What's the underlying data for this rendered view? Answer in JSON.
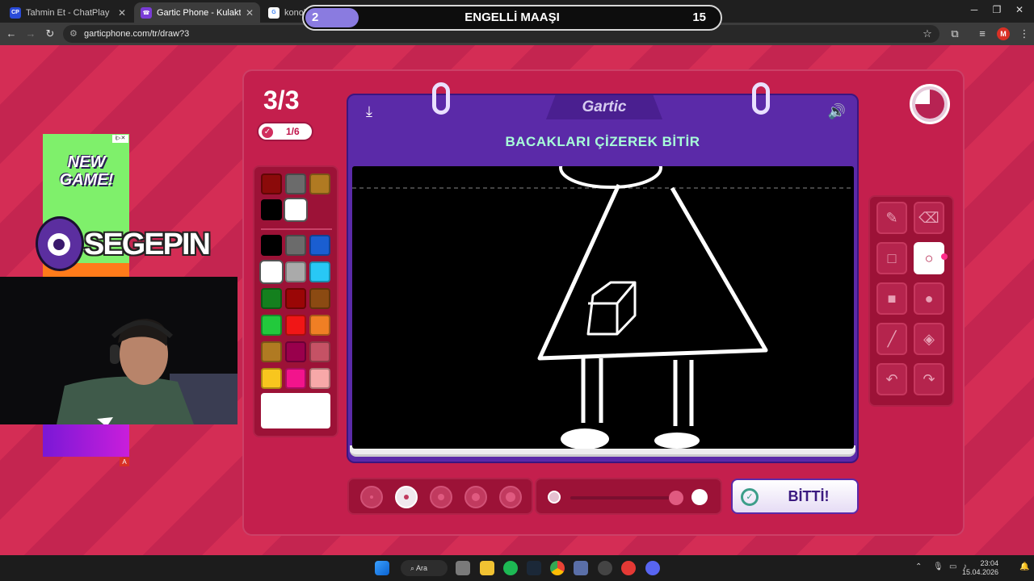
{
  "browser": {
    "tabs": [
      {
        "title": "Tahmin Et - ChatPlay",
        "favicon": "CP",
        "active": false
      },
      {
        "title": "Gartic Phone - Kulaktan Kulağa",
        "favicon": "☎",
        "active": true
      },
      {
        "title": "konoha",
        "favicon": "G",
        "active": false
      }
    ],
    "new_tab_label": "+",
    "url": "garticphone.com/tr/draw?3"
  },
  "round_banner": {
    "count": "2",
    "word": "ENGELLİ MAAŞI",
    "timer": "15"
  },
  "game": {
    "turn": "3/3",
    "rating": "1/6",
    "brand": "Gartic",
    "task": "BACAKLARI ÇİZEREK BİTİR",
    "done_label": "BİTTİ!",
    "selected_tool": "ellipse-outline",
    "selected_color": "#ffffff",
    "brush_sizes": 5,
    "selected_size_index": 1,
    "opacity_percent": 100,
    "timer_remaining_fraction": 0.25
  },
  "palette": {
    "recent": [
      "#8b0a0a",
      "#6b6b6b",
      "#b07a22",
      "#000000",
      "#ffffff"
    ],
    "colors": [
      "#000000",
      "#6b6b6b",
      "#1a5ed1",
      "#ffffff",
      "#aaaaaa",
      "#28c8f5",
      "#14801e",
      "#9a0606",
      "#8b4a12",
      "#22c93c",
      "#f01616",
      "#f07f24",
      "#b07a22",
      "#99004c",
      "#c55265",
      "#f8c61e",
      "#f2148c",
      "#f7a8a8"
    ],
    "current": "#ffffff"
  },
  "tools": [
    {
      "name": "pencil",
      "icon": "pencil-icon",
      "glyph": "✎",
      "selected": false
    },
    {
      "name": "eraser",
      "icon": "eraser-icon",
      "glyph": "⌫",
      "selected": false
    },
    {
      "name": "rectangle-outline",
      "icon": "square-outline-icon",
      "glyph": "□",
      "selected": false
    },
    {
      "name": "ellipse-outline",
      "icon": "circle-outline-icon",
      "glyph": "○",
      "selected": true
    },
    {
      "name": "rectangle-filled",
      "icon": "square-filled-icon",
      "glyph": "■",
      "selected": false
    },
    {
      "name": "ellipse-filled",
      "icon": "circle-filled-icon",
      "glyph": "●",
      "selected": false
    },
    {
      "name": "line",
      "icon": "line-icon",
      "glyph": "╱",
      "selected": false
    },
    {
      "name": "fill",
      "icon": "bucket-icon",
      "glyph": "◈",
      "selected": false
    },
    {
      "name": "undo",
      "icon": "undo-icon",
      "glyph": "↶",
      "selected": false
    },
    {
      "name": "redo",
      "icon": "redo-icon",
      "glyph": "↷",
      "selected": false
    }
  ],
  "overlay": {
    "ad_text": "NEW GAME!",
    "ad_tag": "i▷✕",
    "ad_badge": "A",
    "streamer_name": "SEGEPIN"
  },
  "taskbar": {
    "search_label": "Ara",
    "time": "23:04",
    "date": "15.04.2026"
  },
  "icons": {
    "back": "←",
    "forward": "→",
    "reload": "↻",
    "download": "⤓",
    "sound": "🔊",
    "star": "☆",
    "extensions": "⧉",
    "menu": "⋮",
    "profile": "M"
  }
}
